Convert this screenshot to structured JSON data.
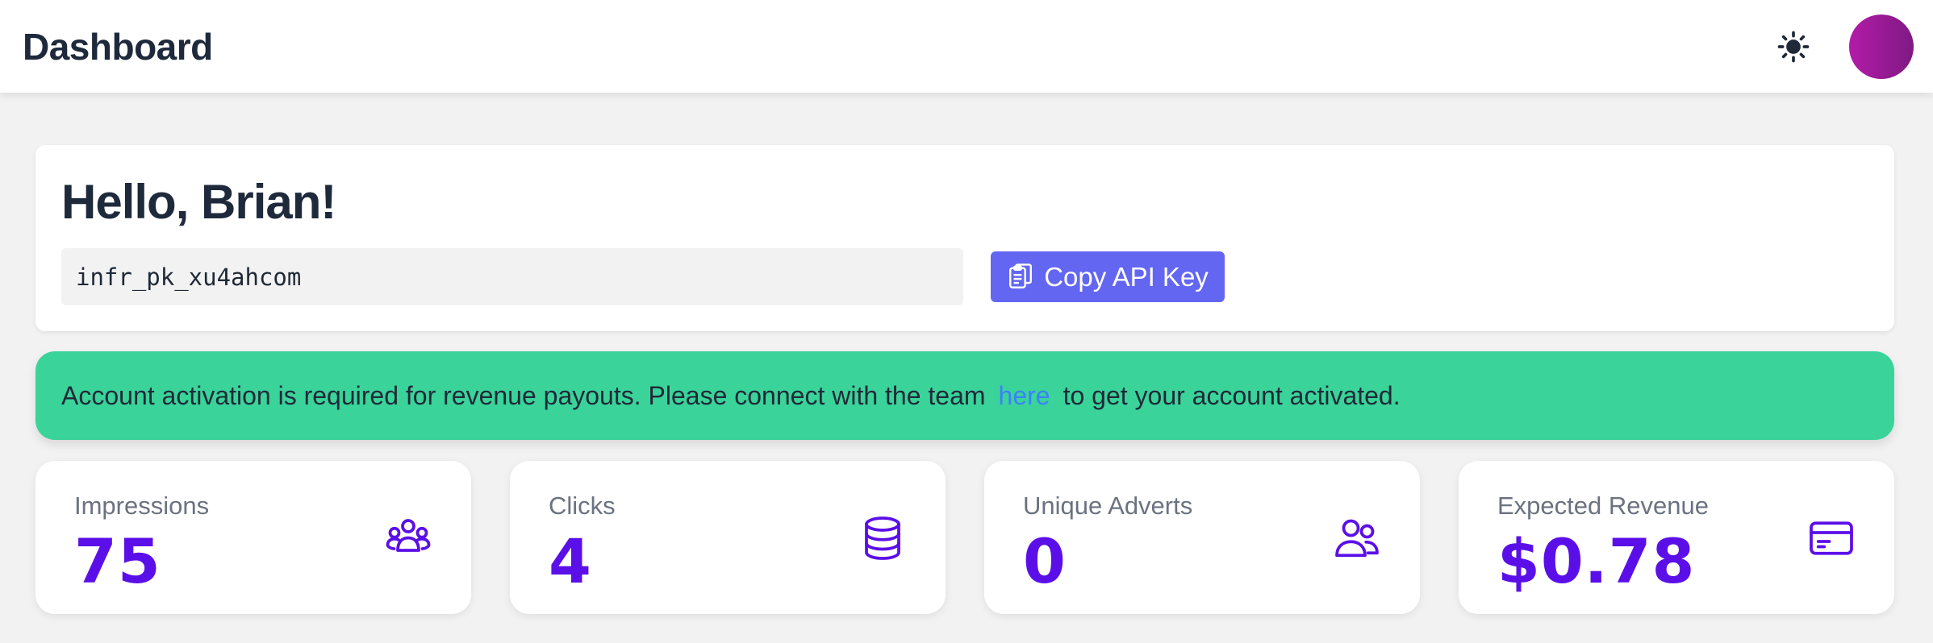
{
  "header": {
    "title": "Dashboard",
    "theme_icon": "sun-icon",
    "avatar_colors": [
      "#b31ba8",
      "#7f1a83"
    ]
  },
  "welcome": {
    "greeting": "Hello, Brian!",
    "api_key": "infr_pk_xu4ahcom",
    "copy_button_label": "Copy API Key",
    "copy_icon": "clipboard-icon"
  },
  "alert": {
    "text_before": "Account activation is required for revenue payouts. Please connect with the team",
    "link_text": "here",
    "text_after": "to get your account activated.",
    "background": "#3ad39a"
  },
  "stats": [
    {
      "label": "Impressions",
      "value": "75",
      "icon": "user-group-icon"
    },
    {
      "label": "Clicks",
      "value": "4",
      "icon": "database-icon"
    },
    {
      "label": "Unique Adverts",
      "value": "0",
      "icon": "users-icon"
    },
    {
      "label": "Expected Revenue",
      "value": "$0.78",
      "icon": "credit-card-icon"
    }
  ],
  "colors": {
    "accent": "#6366f1",
    "stat_value": "#5b0fe8",
    "link": "#3b82f6"
  }
}
